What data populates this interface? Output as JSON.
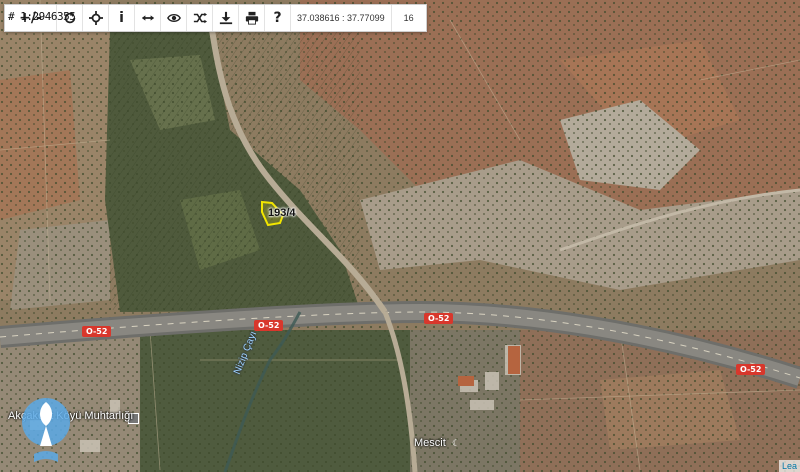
{
  "toolbar": {
    "scale_text": "# 1:2946355",
    "buttons": [
      {
        "name": "measure-button",
        "icon": "plus-minus-icon"
      },
      {
        "name": "refresh-button",
        "icon": "refresh-icon"
      },
      {
        "name": "locate-button",
        "icon": "crosshair-icon"
      },
      {
        "name": "info-button",
        "icon": "info-icon"
      },
      {
        "name": "distance-button",
        "icon": "arrows-horizontal-icon"
      },
      {
        "name": "view-button",
        "icon": "eye-icon"
      },
      {
        "name": "shuffle-button",
        "icon": "shuffle-icon"
      },
      {
        "name": "download-button",
        "icon": "download-icon"
      },
      {
        "name": "print-button",
        "icon": "print-icon"
      },
      {
        "name": "help-button",
        "icon": "question-icon"
      }
    ],
    "coordinates": "37.038616 : 37.77099",
    "zoom": "16"
  },
  "map": {
    "parcel_label": "193/4",
    "roads": [
      {
        "label": "O-52"
      },
      {
        "label": "O-52"
      },
      {
        "label": "O-52"
      },
      {
        "label": "O-52"
      }
    ],
    "river_label": "Nizip Çayı",
    "places": {
      "muhtarlik": "Akçakent Köyü Muhtarlığı",
      "mescit": "Mescit"
    },
    "colors": {
      "parcel_outline": "#f2e600",
      "road_badge": "#d8372c"
    }
  },
  "attribution": "Lea"
}
